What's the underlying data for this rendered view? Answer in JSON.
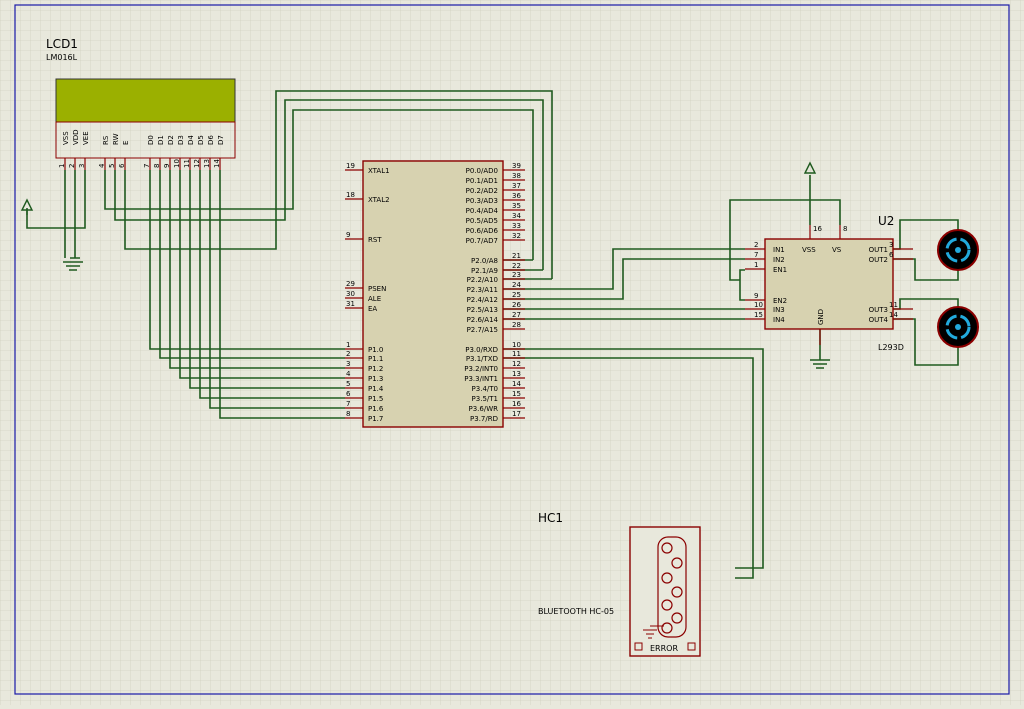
{
  "lcd": {
    "ref": "LCD1",
    "model": "LM016L",
    "pins": [
      {
        "name": "VSS",
        "num": "1"
      },
      {
        "name": "VDD",
        "num": "2"
      },
      {
        "name": "VEE",
        "num": "3"
      },
      {
        "name": "RS",
        "num": "4"
      },
      {
        "name": "RW",
        "num": "5"
      },
      {
        "name": "E",
        "num": "6"
      },
      {
        "name": "D0",
        "num": "7"
      },
      {
        "name": "D1",
        "num": "8"
      },
      {
        "name": "D2",
        "num": "9"
      },
      {
        "name": "D3",
        "num": "10"
      },
      {
        "name": "D4",
        "num": "11"
      },
      {
        "name": "D5",
        "num": "12"
      },
      {
        "name": "D6",
        "num": "13"
      },
      {
        "name": "D7",
        "num": "14"
      }
    ]
  },
  "mcu": {
    "left_pins": [
      {
        "name": "XTAL1",
        "num": "19"
      },
      {
        "name": "XTAL2",
        "num": "18"
      },
      {
        "name": "RST",
        "num": "9"
      },
      {
        "name": "PSEN",
        "num": "29"
      },
      {
        "name": "ALE",
        "num": "30"
      },
      {
        "name": "EA",
        "num": "31"
      },
      {
        "name": "P1.0",
        "num": "1"
      },
      {
        "name": "P1.1",
        "num": "2"
      },
      {
        "name": "P1.2",
        "num": "3"
      },
      {
        "name": "P1.3",
        "num": "4"
      },
      {
        "name": "P1.4",
        "num": "5"
      },
      {
        "name": "P1.5",
        "num": "6"
      },
      {
        "name": "P1.6",
        "num": "7"
      },
      {
        "name": "P1.7",
        "num": "8"
      }
    ],
    "right_pins": [
      {
        "name": "P0.0/AD0",
        "num": "39"
      },
      {
        "name": "P0.1/AD1",
        "num": "38"
      },
      {
        "name": "P0.2/AD2",
        "num": "37"
      },
      {
        "name": "P0.3/AD3",
        "num": "36"
      },
      {
        "name": "P0.4/AD4",
        "num": "35"
      },
      {
        "name": "P0.5/AD5",
        "num": "34"
      },
      {
        "name": "P0.6/AD6",
        "num": "33"
      },
      {
        "name": "P0.7/AD7",
        "num": "32"
      },
      {
        "name": "P2.0/A8",
        "num": "21"
      },
      {
        "name": "P2.1/A9",
        "num": "22"
      },
      {
        "name": "P2.2/A10",
        "num": "23"
      },
      {
        "name": "P2.3/A11",
        "num": "24"
      },
      {
        "name": "P2.4/A12",
        "num": "25"
      },
      {
        "name": "P2.5/A13",
        "num": "26"
      },
      {
        "name": "P2.6/A14",
        "num": "27"
      },
      {
        "name": "P2.7/A15",
        "num": "28"
      },
      {
        "name": "P3.0/RXD",
        "num": "10"
      },
      {
        "name": "P3.1/TXD",
        "num": "11"
      },
      {
        "name": "P3.2/INT0",
        "num": "12"
      },
      {
        "name": "P3.3/INT1",
        "num": "13"
      },
      {
        "name": "P3.4/T0",
        "num": "14"
      },
      {
        "name": "P3.5/T1",
        "num": "15"
      },
      {
        "name": "P3.6/WR",
        "num": "16"
      },
      {
        "name": "P3.7/RD",
        "num": "17"
      }
    ]
  },
  "driver": {
    "ref": "U2",
    "model": "L293D",
    "left_pins": [
      {
        "name": "IN1",
        "num": "2"
      },
      {
        "name": "IN2",
        "num": "7"
      },
      {
        "name": "EN1",
        "num": "1"
      },
      {
        "name": "EN2",
        "num": "9"
      },
      {
        "name": "IN3",
        "num": "10"
      },
      {
        "name": "IN4",
        "num": "15"
      }
    ],
    "right_pins": [
      {
        "name": "OUT1",
        "num": "3"
      },
      {
        "name": "OUT2",
        "num": "6"
      },
      {
        "name": "OUT3",
        "num": "11"
      },
      {
        "name": "OUT4",
        "num": "14"
      }
    ],
    "top_pins": [
      {
        "name": "VSS",
        "num": "16"
      },
      {
        "name": "VS",
        "num": "8"
      }
    ],
    "bottom_pins": [
      {
        "name": "GND",
        "num": ""
      }
    ]
  },
  "bluetooth": {
    "ref": "HC1",
    "model": "BLUETOOTH HC-05",
    "status": "ERROR"
  }
}
